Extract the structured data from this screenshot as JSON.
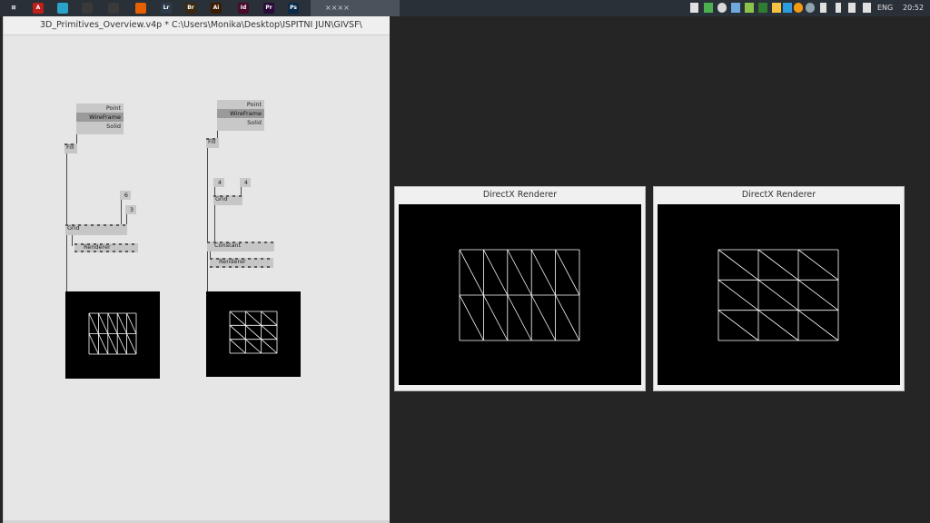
{
  "taskbar": {
    "active_task": "××××",
    "language": "ENG",
    "clock": "20:52",
    "apps": [
      {
        "name": "windows-start-icon",
        "color": "#2a3038",
        "glyph": "⊞"
      },
      {
        "name": "acrobat-icon",
        "color": "#c0201c",
        "glyph": "A"
      },
      {
        "name": "sketch-icon",
        "color": "#2aa3c8",
        "glyph": ""
      },
      {
        "name": "film-icon",
        "color": "#3a3a3a",
        "glyph": ""
      },
      {
        "name": "inkscape-icon",
        "color": "#3a3a3a",
        "glyph": ""
      },
      {
        "name": "firefox-icon",
        "color": "#e66000",
        "glyph": ""
      },
      {
        "name": "lightroom-icon",
        "color": "#2d3a4a",
        "glyph": "Lr"
      },
      {
        "name": "bridge-icon",
        "color": "#3b2a10",
        "glyph": "Br"
      },
      {
        "name": "illustrator-icon",
        "color": "#3a1c00",
        "glyph": "Ai"
      },
      {
        "name": "indesign-icon",
        "color": "#4a0a2a",
        "glyph": "Id"
      },
      {
        "name": "premiere-icon",
        "color": "#2a0a3a",
        "glyph": "Pr"
      },
      {
        "name": "photoshop-icon",
        "color": "#0a2a4a",
        "glyph": "Ps"
      }
    ]
  },
  "patch": {
    "title": "3D_Primitives_Overview.v4p *  C:\\Users\\Monika\\Desktop\\ISPITNI JUN\\GIVSF\\",
    "left": {
      "fill_modes": [
        "Point",
        "WireFrame",
        "Solid"
      ],
      "fill_selected": 1,
      "fill_label": "Fill",
      "res_x": "6",
      "res_y": "3",
      "grid_label": "Grid",
      "renderer_label": "Renderer"
    },
    "right": {
      "fill_modes": [
        "Point",
        "WireFrame",
        "Solid"
      ],
      "fill_selected": 1,
      "fill_label": "Fill",
      "res_x": "4",
      "res_y": "4",
      "grid_label": "Grid",
      "constant_label": "Constant",
      "renderer_label": "Renderer"
    }
  },
  "renderers": [
    {
      "title": "DirectX Renderer",
      "grid": {
        "cols": 5,
        "rows": 2
      }
    },
    {
      "title": "DirectX Renderer",
      "grid": {
        "cols": 3,
        "rows": 3
      }
    }
  ],
  "colors": {
    "wire": "#ffffff",
    "background": "#000000",
    "selected": "#9a9a9a"
  }
}
